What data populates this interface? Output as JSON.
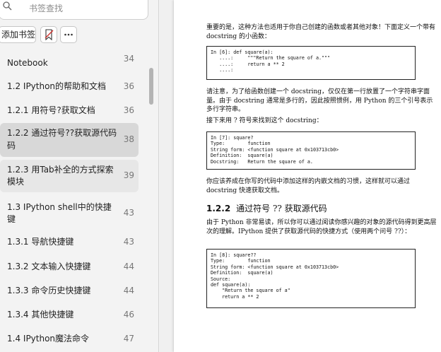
{
  "sidebar": {
    "search_placeholder": "书签查找",
    "add_bookmark_label": "添加书签",
    "toc": [
      {
        "label": "Notebook",
        "page": "34"
      },
      {
        "label": "1.2   IPython的帮助和文档",
        "page": "36"
      },
      {
        "label": "1.2.1   用符号?获取文档",
        "page": "36"
      },
      {
        "label": "1.2.2   通过符号??获取源代码",
        "label2": "码",
        "page": "38"
      },
      {
        "label": "1.2.3   用Tab补全的方式探索",
        "label2": "模块",
        "page": "39"
      },
      {
        "label": "1.3   IPython shell中的快捷",
        "label2": "键",
        "page": "43"
      },
      {
        "label": "1.3.1   导航快捷键",
        "page": "43"
      },
      {
        "label": "1.3.2   文本输入快捷键",
        "page": "44"
      },
      {
        "label": "1.3.3   命令历史快捷键",
        "page": "44"
      },
      {
        "label": "1.3.4   其他快捷键",
        "page": "46"
      },
      {
        "label": "1.4   IPython魔法命令",
        "page": "47"
      }
    ]
  },
  "document": {
    "para1": "重要的是，这种方法也适用于你自己创建的函数或者其他对象！下面定义一个带有 docstring 的小函数：",
    "code1": "In [6]: def square(a):\n   ....:     \"\"\"Return the square of a.\"\"\"\n   ....:     return a ** 2\n   ....:",
    "para2": "请注意，为了给函数创建一个 docstring，仅仅在第一行放置了一个字符串字面量。由于 docstring 通常是多行的，因此按照惯例，用 Python 的三个引号表示多行字符串。",
    "para3": "接下来用 ? 符号来找到这个 docstring：",
    "code2": "In [7]: square?\nType:        function\nString form: <function square at 0x103713cb0>\nDefinition:  square(a)\nDocstring:   Return the square of a.",
    "para4": "你应该养成在你写的代码中添加这样的内嵌文档的习惯，这样就可以通过 docstring 快速获取文档。",
    "section_number": "1.2.2",
    "section_title": "通过符号 ?? 获取源代码",
    "para5": "由于 Python 非常易读，所以你可以通过阅读你感兴趣的对象的源代码得到更高层次的理解。IPython 提供了获取源代码的快捷方式（使用两个问号 ??）：",
    "code3": "In [8]: square??\nType:        function\nString form: <function square at 0x103713cb0>\nDefinition:  square(a)\nSource:\ndef square(a):\n    \"Return the square of a\"\n    return a ** 2"
  },
  "icons": {
    "search": "search-icon",
    "remove_bookmark": "bookmark-remove-icon",
    "more": "more-horizontal-icon"
  }
}
